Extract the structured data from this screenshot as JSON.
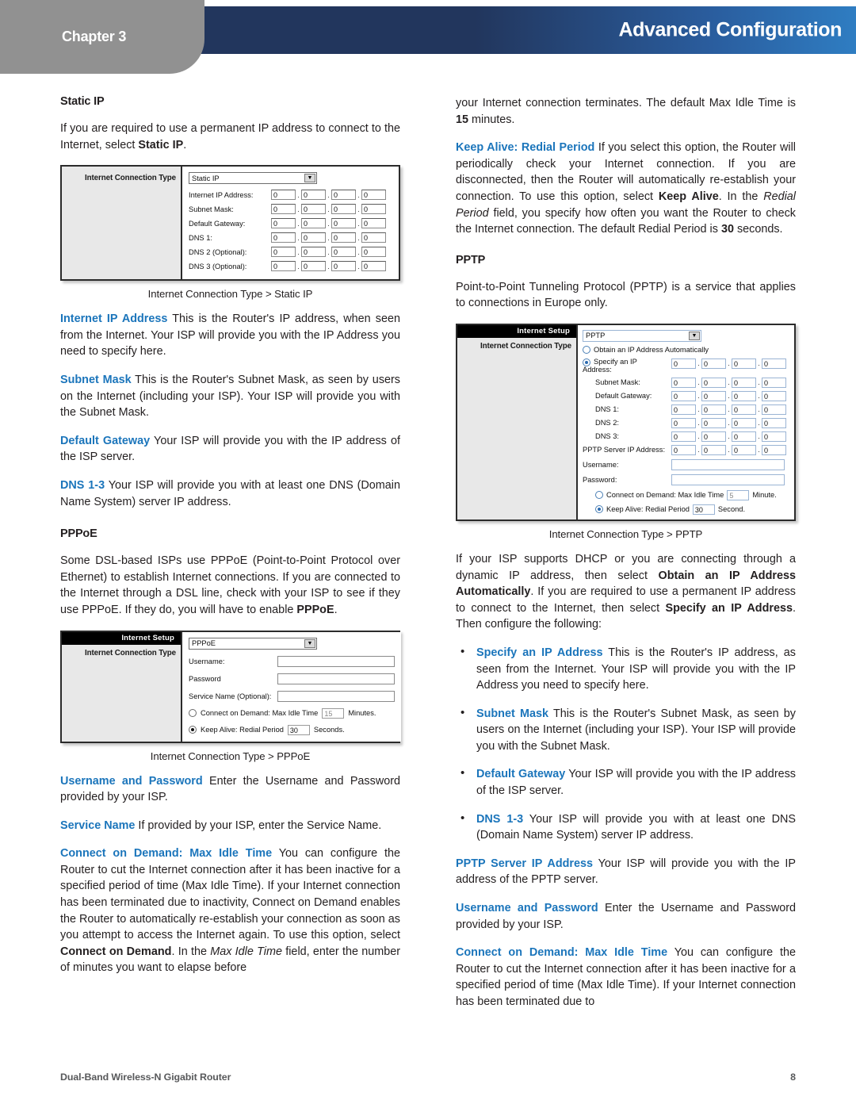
{
  "header": {
    "chapter_label": "Chapter 3",
    "title": "Advanced Configuration",
    "band_color_start": "#22365d",
    "band_color_end": "#2f7dc2",
    "tab_color": "#919191"
  },
  "accent_color": "#1b75bb",
  "left_column": {
    "static_ip_heading": "Static IP",
    "static_ip_intro_a": "If you are required to use a permanent IP address to connect to the Internet, select ",
    "static_ip_intro_b": "Static IP",
    "static_ip_intro_c": ".",
    "figure_static_ip": {
      "caption": "Internet Connection Type > Static IP",
      "section_heading": "Internet Connection Type",
      "select_value": "Static IP",
      "fields": [
        {
          "label": "Internet IP Address:",
          "octets": [
            "0",
            "0",
            "0",
            "0"
          ]
        },
        {
          "label": "Subnet Mask:",
          "octets": [
            "0",
            "0",
            "0",
            "0"
          ]
        },
        {
          "label": "Default Gateway:",
          "octets": [
            "0",
            "0",
            "0",
            "0"
          ]
        },
        {
          "label": "DNS 1:",
          "octets": [
            "0",
            "0",
            "0",
            "0"
          ]
        },
        {
          "label": "DNS 2 (Optional):",
          "octets": [
            "0",
            "0",
            "0",
            "0"
          ]
        },
        {
          "label": "DNS 3 (Optional):",
          "octets": [
            "0",
            "0",
            "0",
            "0"
          ]
        }
      ]
    },
    "terms": [
      {
        "key": "Internet IP Address",
        "text": "  This is the Router's IP address, when seen from the Internet. Your ISP will provide you with the IP Address you need to specify here."
      },
      {
        "key": "Subnet Mask",
        "text": "  This is the Router's Subnet Mask, as seen by users on the Internet (including your ISP). Your ISP will provide you with the Subnet Mask."
      },
      {
        "key": "Default Gateway",
        "text": "  Your ISP will provide you with the IP address of the ISP server."
      },
      {
        "key": "DNS 1-3",
        "text": "  Your ISP will provide you with at least one DNS (Domain Name System) server IP address."
      }
    ],
    "pppoe_heading": "PPPoE",
    "pppoe_intro_a": "Some DSL-based ISPs use PPPoE (Point-to-Point Protocol over Ethernet) to establish Internet connections. If you are connected to the Internet through a DSL line, check with your ISP to see if they use PPPoE. If they do, you will have to enable ",
    "pppoe_intro_b": "PPPoE",
    "pppoe_intro_c": ".",
    "figure_pppoe": {
      "caption": "Internet Connection Type > PPPoE",
      "banner": "Internet Setup",
      "section_heading": "Internet Connection Type",
      "select_value": "PPPoE",
      "text_fields": [
        {
          "label": "Username:",
          "value": ""
        },
        {
          "label": "Password",
          "value": ""
        },
        {
          "label": "Service Name (Optional):",
          "value": ""
        }
      ],
      "connect_on_demand_label_a": "Connect on Demand: Max Idle Time",
      "connect_on_demand_value": "15",
      "connect_on_demand_unit": "Minutes.",
      "connect_on_demand_selected": false,
      "keep_alive_label_a": "Keep Alive: Redial Period",
      "keep_alive_value": "30",
      "keep_alive_unit": "Seconds.",
      "keep_alive_selected": true
    },
    "terms2": [
      {
        "key": "Username and Password",
        "text": "  Enter the Username and Password provided by your ISP."
      },
      {
        "key": "Service Name",
        "text": "  If provided by your ISP, enter the Service Name."
      }
    ],
    "cod_key": "Connect on Demand: Max Idle Time",
    "cod_p1": "  You can configure the Router to cut the Internet connection after it has been inactive for a specified period of time (Max Idle Time). If your Internet connection has been terminated due to inactivity, Connect on Demand enables the Router to automatically re-establish your connection as soon as you attempt to access the Internet again. To use this option, select ",
    "cod_bold1": "Connect on Demand",
    "cod_p2": ". In the ",
    "cod_italic": "Max Idle Time",
    "cod_p3": " field, enter the number of minutes you want to elapse before"
  },
  "right_column": {
    "cont_a": "your Internet connection terminates. The default Max Idle Time is ",
    "cont_bold": "15",
    "cont_b": " minutes.",
    "keepalive_key": "Keep Alive: Redial Period",
    "keepalive_p1": " If you select this option, the Router will periodically check your Internet connection. If you are disconnected, then the Router will automatically re-establish your connection. To use this option, select ",
    "keepalive_bold1": "Keep Alive",
    "keepalive_p2": ". In the ",
    "keepalive_italic": "Redial Period",
    "keepalive_p3": " field, you specify how often you want the Router to check the Internet connection. The default Redial Period is ",
    "keepalive_bold2": "30",
    "keepalive_p4": " seconds.",
    "pptp_heading": "PPTP",
    "pptp_intro": "Point-to-Point Tunneling Protocol (PPTP) is a service that applies to connections in Europe only.",
    "figure_pptp": {
      "caption": "Internet Connection Type > PPTP",
      "banner": "Internet Setup",
      "section_heading": "Internet Connection Type",
      "select_value": "PPTP",
      "radio_obtain_label": "Obtain an IP Address Automatically",
      "radio_obtain_selected": false,
      "radio_specify_label_line1": "Specify an IP",
      "radio_specify_label_line2": "Address:",
      "radio_specify_selected": true,
      "specify_octets": [
        "0",
        "0",
        "0",
        "0"
      ],
      "fields": [
        {
          "label": "Subnet Mask:",
          "octets": [
            "0",
            "0",
            "0",
            "0"
          ]
        },
        {
          "label": "Default Gateway:",
          "octets": [
            "0",
            "0",
            "0",
            "0"
          ]
        },
        {
          "label": "DNS 1:",
          "octets": [
            "0",
            "0",
            "0",
            "0"
          ]
        },
        {
          "label": "DNS 2:",
          "octets": [
            "0",
            "0",
            "0",
            "0"
          ]
        },
        {
          "label": "DNS 3:",
          "octets": [
            "0",
            "0",
            "0",
            "0"
          ]
        },
        {
          "label": "PPTP Server IP Address:",
          "octets": [
            "0",
            "0",
            "0",
            "0"
          ]
        }
      ],
      "text_fields": [
        {
          "label": "Username:",
          "value": ""
        },
        {
          "label": "Password:",
          "value": ""
        }
      ],
      "connect_on_demand_label_a": "Connect on Demand: Max Idle Time",
      "connect_on_demand_value": "5",
      "connect_on_demand_unit": "Minute.",
      "connect_on_demand_selected": false,
      "keep_alive_label_a": "Keep Alive: Redial Period",
      "keep_alive_value": "30",
      "keep_alive_unit": "Second.",
      "keep_alive_selected": true
    },
    "dhcp_p1": "If your ISP supports DHCP or you are connecting through a dynamic IP address, then select ",
    "dhcp_bold1": "Obtain an IP Address Automatically",
    "dhcp_p2": ". If you are required to use a permanent IP address to connect to the Internet, then select ",
    "dhcp_bold2": "Specify an IP Address",
    "dhcp_p3": ". Then configure the following:",
    "bullets": [
      {
        "key": "Specify an IP Address",
        "text": "  This is the Router's IP address, as seen from the Internet. Your ISP will provide you with the IP Address you need to specify here."
      },
      {
        "key": "Subnet Mask",
        "text": " This is the Router's Subnet Mask, as seen by users on the Internet (including your ISP). Your ISP will provide you with the Subnet Mask."
      },
      {
        "key": "Default Gateway",
        "text": "  Your ISP will provide you with the IP address of the ISP server."
      },
      {
        "key": "DNS 1-3",
        "text": "  Your ISP will provide you with at least one DNS (Domain Name System) server IP address."
      }
    ],
    "terms": [
      {
        "key": "PPTP Server IP Address",
        "text": "  Your ISP will provide you with the IP address of the PPTP server."
      },
      {
        "key": "Username and Password",
        "text": "  Enter the Username and Password provided by your ISP."
      }
    ],
    "cod_key": "Connect on Demand: Max Idle Time",
    "cod_text": "  You can configure the Router to cut the Internet connection after it has been inactive for a specified period of time (Max Idle Time). If your Internet connection has been terminated due to"
  },
  "footer": {
    "product": "Dual-Band Wireless-N Gigabit Router",
    "page_number": "8"
  }
}
